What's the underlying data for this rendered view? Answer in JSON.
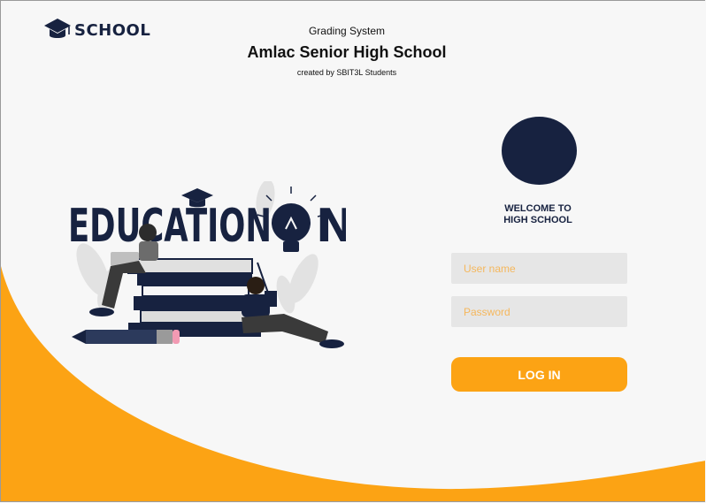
{
  "brand": {
    "logo_text": "SCHOOL"
  },
  "header": {
    "subtitle": "Grading System",
    "title": "Amlac Senior High School",
    "credit": "created by SBIT3L Students"
  },
  "illustration": {
    "banner_text": "EDUCATION"
  },
  "login": {
    "welcome_line1": "WELCOME TO",
    "welcome_line2": "HIGH SCHOOL",
    "username_placeholder": "User name",
    "password_placeholder": "Password",
    "button_label": "LOG IN"
  },
  "colors": {
    "navy": "#172240",
    "orange": "#fca314",
    "field_bg": "#e6e6e6",
    "placeholder": "#f5b75c",
    "page_bg": "#f7f7f7"
  }
}
